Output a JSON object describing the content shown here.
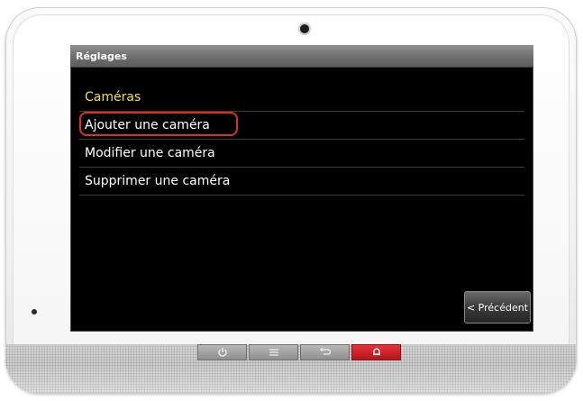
{
  "screen": {
    "title": "Réglages",
    "section_header": "Caméras",
    "items": [
      {
        "label": "Ajouter une caméra"
      },
      {
        "label": "Modifier une caméra"
      },
      {
        "label": "Supprimer une caméra"
      }
    ],
    "back_button_label": "< Précédent"
  },
  "colors": {
    "section_header": "#f0e13a",
    "highlight_outline": "#d8302a",
    "alarm_button": "#c81d24"
  },
  "hardware_buttons": [
    {
      "icon": "power-icon"
    },
    {
      "icon": "menu-icon"
    },
    {
      "icon": "back-icon"
    },
    {
      "icon": "alarm-bell-icon"
    }
  ]
}
